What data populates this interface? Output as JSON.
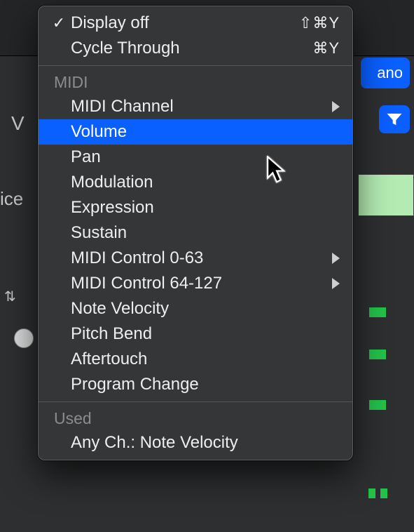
{
  "background": {
    "pill_text": "ano",
    "v_label": "V",
    "ice_label": "ice"
  },
  "menu": {
    "top": [
      {
        "label": "Display off",
        "checked": true,
        "shortcut": "⇧⌘Y"
      },
      {
        "label": "Cycle Through",
        "checked": false,
        "shortcut": "⌘Y"
      }
    ],
    "sections": [
      {
        "header": "MIDI",
        "items": [
          {
            "label": "MIDI Channel",
            "submenu": true
          },
          {
            "label": "Volume",
            "highlighted": true
          },
          {
            "label": "Pan"
          },
          {
            "label": "Modulation"
          },
          {
            "label": "Expression"
          },
          {
            "label": "Sustain"
          },
          {
            "label": "MIDI Control 0-63",
            "submenu": true
          },
          {
            "label": "MIDI Control 64-127",
            "submenu": true
          },
          {
            "label": "Note Velocity"
          },
          {
            "label": "Pitch Bend"
          },
          {
            "label": "Aftertouch"
          },
          {
            "label": "Program Change"
          }
        ]
      },
      {
        "header": "Used",
        "items": [
          {
            "label": "Any Ch.: Note Velocity"
          }
        ]
      }
    ]
  }
}
